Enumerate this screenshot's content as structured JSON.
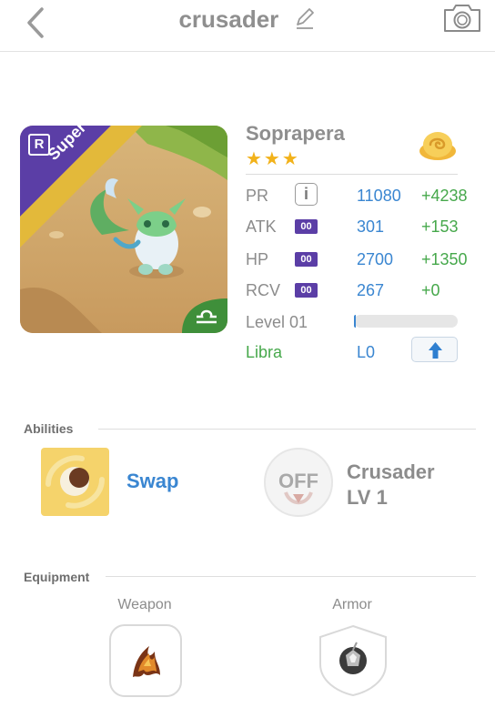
{
  "header": {
    "title": "crusader"
  },
  "monster": {
    "name": "Soprapera",
    "stars": "★★★",
    "rarity_badge": "R",
    "banner": "Super",
    "level_label": "Level 01",
    "level_progress": 0.02,
    "zodiac": "Libra",
    "level_code": "L0"
  },
  "stats": [
    {
      "label": "PR",
      "badge": "",
      "value": "11080",
      "bonus": "+4238"
    },
    {
      "label": "ATK",
      "badge": "00",
      "value": "301",
      "bonus": "+153"
    },
    {
      "label": "HP",
      "badge": "00",
      "value": "2700",
      "bonus": "+1350"
    },
    {
      "label": "RCV",
      "badge": "00",
      "value": "267",
      "bonus": "+0"
    }
  ],
  "info_icon": "i",
  "abilities": {
    "title": "Abilities",
    "primary": {
      "label": "Swap"
    },
    "secondary": {
      "off_label": "OFF",
      "name": "Crusader",
      "level": "LV 1"
    }
  },
  "equipment": {
    "title": "Equipment",
    "weapon_label": "Weapon",
    "armor_label": "Armor"
  },
  "colors": {
    "blue": "#3a86d1",
    "green": "#46a84b",
    "purple": "#5b3ea6",
    "star": "#f2b21a"
  }
}
